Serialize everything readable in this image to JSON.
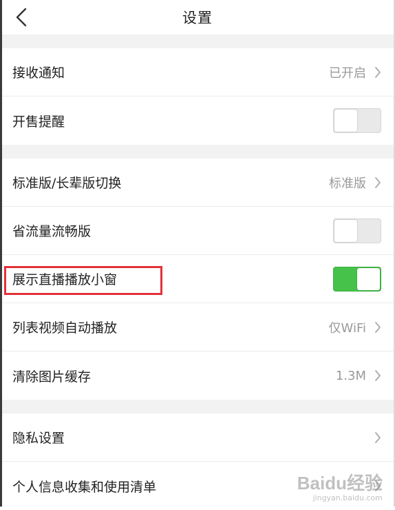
{
  "nav": {
    "title": "设置",
    "back_icon": "chevron-left-icon"
  },
  "colors": {
    "toggle_on": "#46c24a",
    "toggle_off": "#e9e9e9",
    "highlight": "#e2313a",
    "value_text": "#999999"
  },
  "group1": {
    "receive_notifications": {
      "label": "接收通知",
      "value": "已开启"
    },
    "sale_reminder": {
      "label": "开售提醒",
      "toggle": false
    }
  },
  "group2": {
    "version_switch": {
      "label": "标准版/长辈版切换",
      "value": "标准版"
    },
    "data_saver": {
      "label": "省流量流畅版",
      "toggle": false
    },
    "live_mini_window": {
      "label": "展示直播播放小窗",
      "toggle": true
    },
    "autoplay": {
      "label": "列表视频自动播放",
      "value": "仅WiFi"
    },
    "clear_cache": {
      "label": "清除图片缓存",
      "value": "1.3M"
    }
  },
  "group3": {
    "privacy": {
      "label": "隐私设置"
    },
    "personal_info": {
      "label": "个人信息收集和使用清单"
    }
  },
  "watermark": {
    "main": "Baidu经验",
    "sub": "jingyan.baidu.com"
  }
}
